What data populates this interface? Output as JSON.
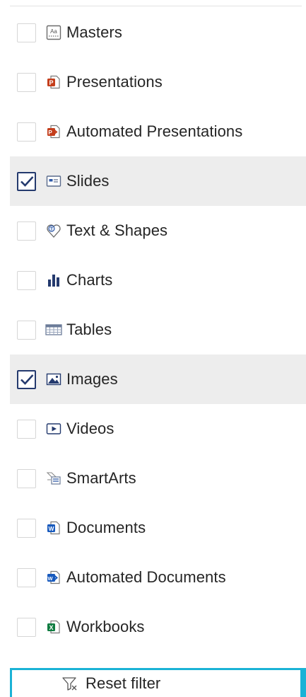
{
  "filters": [
    {
      "label": "Masters",
      "icon": "masters-icon",
      "checked": false
    },
    {
      "label": "Presentations",
      "icon": "powerpoint-icon",
      "checked": false
    },
    {
      "label": "Automated Presentations",
      "icon": "automated-powerpoint-icon",
      "checked": false
    },
    {
      "label": "Slides",
      "icon": "slide-icon",
      "checked": true
    },
    {
      "label": "Text & Shapes",
      "icon": "text-shapes-icon",
      "checked": false
    },
    {
      "label": "Charts",
      "icon": "bar-chart-icon",
      "checked": false
    },
    {
      "label": "Tables",
      "icon": "table-icon",
      "checked": false
    },
    {
      "label": "Images",
      "icon": "image-icon",
      "checked": true
    },
    {
      "label": "Videos",
      "icon": "video-icon",
      "checked": false
    },
    {
      "label": "SmartArts",
      "icon": "smartart-icon",
      "checked": false
    },
    {
      "label": "Documents",
      "icon": "word-icon",
      "checked": false
    },
    {
      "label": "Automated Documents",
      "icon": "automated-word-icon",
      "checked": false
    },
    {
      "label": "Workbooks",
      "icon": "excel-icon",
      "checked": false
    }
  ],
  "reset": {
    "label": "Reset filter",
    "icon": "filter-clear-icon"
  },
  "colors": {
    "checked_row_bg": "#ededed",
    "checkbox_checked": "#243a6e",
    "focus_border": "#1ab2d6",
    "powerpoint": "#c43e1c",
    "word": "#185abd",
    "excel": "#107c41"
  }
}
